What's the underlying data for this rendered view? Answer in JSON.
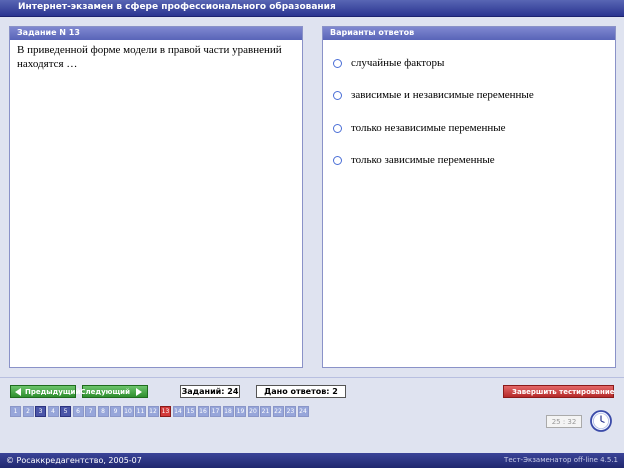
{
  "window": {
    "title": "Интернет-экзамен в сфере профессионального образования"
  },
  "question": {
    "header": "Задание N 13",
    "text": "В приведенной форме модели в правой части уравнений находятся …"
  },
  "answers": {
    "header": "Варианты ответов",
    "options": [
      {
        "label": "случайные факторы"
      },
      {
        "label": "зависимые и независимые переменные"
      },
      {
        "label": "только независимые переменные"
      },
      {
        "label": "только зависимые переменные"
      }
    ]
  },
  "nav": {
    "prev_label": "Предыдущий",
    "next_label": "Следующий",
    "total_label": "Заданий: 24",
    "answered_label": "Дано ответов: 2",
    "finish_label": "Завершить тестирование"
  },
  "pages": [
    {
      "label": "1",
      "state": "normal"
    },
    {
      "label": "2",
      "state": "normal"
    },
    {
      "label": "3",
      "state": "done"
    },
    {
      "label": "4",
      "state": "normal"
    },
    {
      "label": "5",
      "state": "done"
    },
    {
      "label": "6",
      "state": "normal"
    },
    {
      "label": "7",
      "state": "normal"
    },
    {
      "label": "8",
      "state": "normal"
    },
    {
      "label": "9",
      "state": "normal"
    },
    {
      "label": "10",
      "state": "normal"
    },
    {
      "label": "11",
      "state": "normal"
    },
    {
      "label": "12",
      "state": "normal"
    },
    {
      "label": "13",
      "state": "current"
    },
    {
      "label": "14",
      "state": "normal"
    },
    {
      "label": "15",
      "state": "normal"
    },
    {
      "label": "16",
      "state": "normal"
    },
    {
      "label": "17",
      "state": "normal"
    },
    {
      "label": "18",
      "state": "normal"
    },
    {
      "label": "19",
      "state": "normal"
    },
    {
      "label": "20",
      "state": "normal"
    },
    {
      "label": "21",
      "state": "normal"
    },
    {
      "label": "22",
      "state": "normal"
    },
    {
      "label": "23",
      "state": "normal"
    },
    {
      "label": "24",
      "state": "normal"
    }
  ],
  "timer": {
    "value": "25 : 32"
  },
  "status": {
    "left": "© Росаккредагентство, 2005-07",
    "right": "Тест-Экзаменатор off-line 4.5.1"
  },
  "icons": {
    "prev": "arrow-left-icon",
    "next": "arrow-right-icon",
    "finish": "running-man-icon",
    "clock": "clock-icon"
  },
  "colors": {
    "title_bar": "#2a3490",
    "panel_header": "#5864b8",
    "nav_button": "#2f8f2f",
    "finish_button": "#b52a2a",
    "current_page": "#d23a3a",
    "done_page": "#4a55a8"
  }
}
